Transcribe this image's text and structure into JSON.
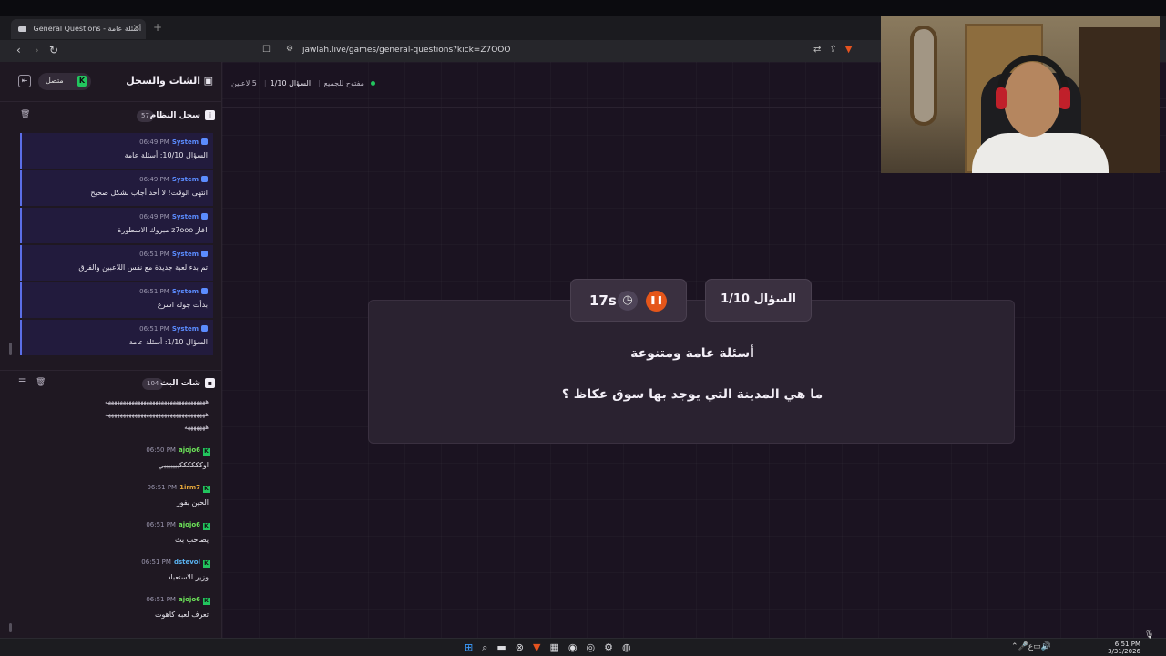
{
  "browser": {
    "tab_title": "General Questions - أسئلة عامة",
    "tab_close": "×",
    "new_tab": "+",
    "url": "jawlah.live/games/general-questions?kick=Z7OOO",
    "back": "‹",
    "forward": "›",
    "reload": "↻"
  },
  "sidebar": {
    "title": "الشات والسجل",
    "status": "متصل",
    "kick_badge": "K",
    "system_log": {
      "title": "سجل النظام",
      "count": "57",
      "messages": [
        {
          "time": "06:49 PM",
          "user": "System",
          "text": "السؤال 10/10: أسئلة عامة"
        },
        {
          "time": "06:49 PM",
          "user": "System",
          "text": "انتهى الوقت! لا أحد أجاب بشكل صحيح"
        },
        {
          "time": "06:49 PM",
          "user": "System",
          "text": "مبروك الاسطورة z7ooo فاز!"
        },
        {
          "time": "06:51 PM",
          "user": "System",
          "text": "تم بدء لعبة جديدة مع نفس اللاعبين والفرق"
        },
        {
          "time": "06:51 PM",
          "user": "System",
          "text": "بدأت جوله اسرع"
        },
        {
          "time": "06:51 PM",
          "user": "System",
          "text": "السؤال 1/10: أسئلة عامة"
        }
      ]
    },
    "stream_chat": {
      "title": "شات البث",
      "count": "104",
      "spam_lines": [
        "ههههههههههههههههههههههههههههههههههه",
        "ههههههههههههههههههههههههههههههههههه",
        "هههههههه"
      ],
      "messages": [
        {
          "time": "06:50 PM",
          "user": "ajojo6",
          "color": "#6ee75a",
          "text": "اوككككككيييييييي"
        },
        {
          "time": "06:51 PM",
          "user": "1irm7",
          "color": "#e6a73a",
          "text": "الحين بفوز"
        },
        {
          "time": "06:51 PM",
          "user": "ajojo6",
          "color": "#6ee75a",
          "text": "يصاحب بث"
        },
        {
          "time": "06:51 PM",
          "user": "dstevol",
          "color": "#5ab2f0",
          "text": "وزير الاستعباد"
        },
        {
          "time": "06:51 PM",
          "user": "ajojo6",
          "color": "#6ee75a",
          "text": "تعرف لعبه كاهوت"
        }
      ]
    }
  },
  "game": {
    "players": "5 لاعبين",
    "question_label": "السؤال 1/10",
    "open_label": "مفتوح للجميع",
    "timer": "17s",
    "question_number": "السؤال 1/10",
    "category": "أسئلة عامة ومتنوعة",
    "question": "ما هي المدينة التي يوجد بها سوق عكاظ ؟"
  },
  "taskbar": {
    "time": "6:51 PM",
    "date": "3/31/2026"
  },
  "colors": {
    "accent_orange": "#e5561a",
    "system_blue": "#5b8cff",
    "online_green": "#22c55e"
  }
}
